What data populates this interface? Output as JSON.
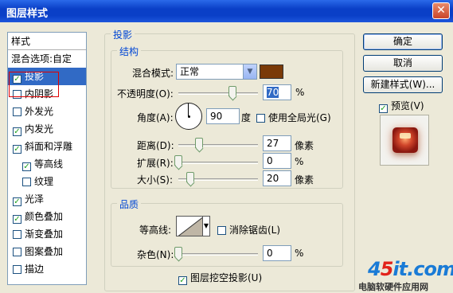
{
  "window": {
    "title": "图层样式",
    "close_glyph": "✕"
  },
  "styles_list": {
    "header": "样式",
    "blend_options": "混合选项:自定",
    "items": [
      {
        "label": "投影",
        "checked": true,
        "selected": true
      },
      {
        "label": "内阴影",
        "checked": false
      },
      {
        "label": "外发光",
        "checked": false
      },
      {
        "label": "内发光",
        "checked": true
      },
      {
        "label": "斜面和浮雕",
        "checked": true
      },
      {
        "label": "等高线",
        "checked": true,
        "indent": true
      },
      {
        "label": "纹理",
        "checked": false,
        "indent": true
      },
      {
        "label": "光泽",
        "checked": true
      },
      {
        "label": "颜色叠加",
        "checked": true
      },
      {
        "label": "渐变叠加",
        "checked": false
      },
      {
        "label": "图案叠加",
        "checked": false
      },
      {
        "label": "描边",
        "checked": false
      }
    ]
  },
  "drop_shadow": {
    "title": "投影",
    "structure": {
      "title": "结构",
      "blend_mode_label": "混合模式:",
      "blend_mode": "正常",
      "shadow_color": "#7a3a08",
      "opacity_label": "不透明度(O):",
      "opacity": "70",
      "percent": "%",
      "angle_label": "角度(A):",
      "angle": "90",
      "angle_unit": "度",
      "global_light_label": "使用全局光(G)",
      "global_light": false,
      "distance_label": "距离(D):",
      "distance": "27",
      "spread_label": "扩展(R):",
      "spread": "0",
      "size_label": "大小(S):",
      "size": "20",
      "pixels": "像素"
    },
    "quality": {
      "title": "品质",
      "contour_label": "等高线:",
      "anti_alias_label": "消除锯齿(L)",
      "anti_alias": false,
      "noise_label": "杂色(N):",
      "noise": "0",
      "percent": "%"
    },
    "knockout_label": "图层挖空投影(U)",
    "knockout": true
  },
  "buttons": {
    "ok": "确定",
    "cancel": "取消",
    "new_style": "新建样式(W)...",
    "preview_label": "预览(V)",
    "preview": true
  },
  "watermark": {
    "logo_prefix": "4",
    "logo_mid": "5",
    "logo_suffix": "it.com",
    "text": "电脑软硬件应用网"
  }
}
